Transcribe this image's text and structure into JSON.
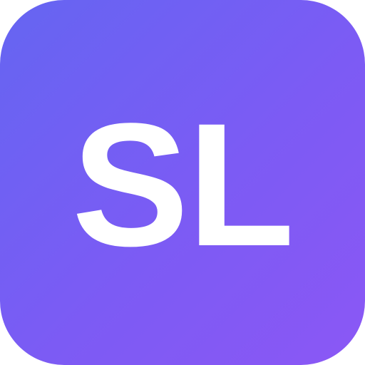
{
  "icon": {
    "monogram": "SL",
    "colors": {
      "gradient_start": "#6565f2",
      "gradient_end": "#8b57f5",
      "text": "#ffffff"
    }
  }
}
